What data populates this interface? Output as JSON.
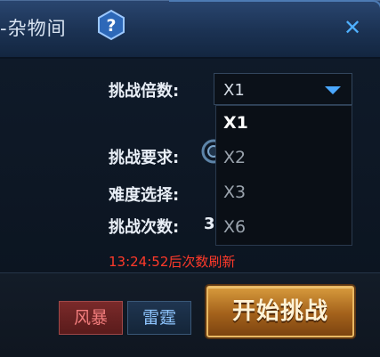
{
  "window": {
    "title": "-杂物间",
    "help_icon": "question-mark-hexagon-icon",
    "close_glyph": "✕"
  },
  "form": {
    "multiplier_label": "挑战倍数:",
    "multiplier_selected": "X1",
    "multiplier_options": [
      "X1",
      "X2",
      "X3",
      "X6"
    ],
    "requirement_label": "挑战要求:",
    "difficulty_label": "难度选择:",
    "count_label": "挑战次数:",
    "count_value": "3",
    "refresh_text": "13:24:52后次数刷新"
  },
  "buttons": {
    "storm": "风暴",
    "thunder": "雷霆",
    "start": "开始挑战"
  },
  "colors": {
    "accent_blue": "#4aa7ff",
    "refresh_red": "#ff3a2a",
    "start_gold": "#d79a3c",
    "storm_red": "#7a2a2a"
  }
}
